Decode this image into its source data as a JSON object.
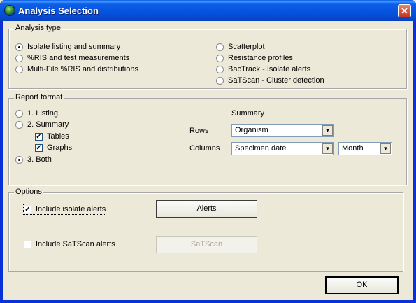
{
  "window": {
    "title": "Analysis Selection",
    "close_glyph": "✕",
    "icon": "app-globe-icon"
  },
  "analysis_type": {
    "legend": "Analysis type",
    "options_left": [
      {
        "label": "Isolate listing and summary",
        "checked": true
      },
      {
        "label": "%RIS and test measurements",
        "checked": false
      },
      {
        "label": "Multi-File %RIS and distributions",
        "checked": false
      }
    ],
    "options_right": [
      {
        "label": "Scatterplot",
        "checked": false
      },
      {
        "label": "Resistance profiles",
        "checked": false
      },
      {
        "label": "BacTrack - Isolate alerts",
        "checked": false
      },
      {
        "label": "SaTScan - Cluster detection",
        "checked": false
      }
    ]
  },
  "report_format": {
    "legend": "Report format",
    "listing": "1. Listing",
    "summary": "2. Summary",
    "tables": "Tables",
    "graphs": "Graphs",
    "both": "3. Both",
    "check_mark": "✓",
    "summary_heading": "Summary",
    "rows_label": "Rows",
    "rows_value": "Organism",
    "columns_label": "Columns",
    "columns_value": "Specimen date",
    "period_value": "Month",
    "arrow": "▼"
  },
  "options": {
    "legend": "Options",
    "include_isolate_alerts": "Include isolate alerts",
    "include_satscan_alerts": "Include SaTScan alerts",
    "alerts_button": "Alerts",
    "satscan_button": "SaTScan"
  },
  "ok_button": "OK"
}
